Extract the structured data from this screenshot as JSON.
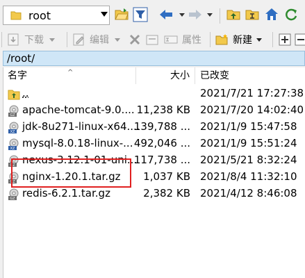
{
  "toolbar": {
    "directory": "root",
    "download_label": "下载",
    "edit_label": "编辑",
    "properties_label": "属性",
    "new_label": "新建"
  },
  "path": "/root/",
  "columns": {
    "name": "名字",
    "size": "大小",
    "modified": "已改变"
  },
  "files": [
    {
      "name": "..",
      "size": "",
      "modified": "2021/7/21 17:27:38",
      "icon": "parent-folder-icon"
    },
    {
      "name": "apache-tomcat-9.0....",
      "size": "11,238 KB",
      "modified": "2021/7/20 14:02:40",
      "icon": "gz-archive-icon"
    },
    {
      "name": "jdk-8u271-linux-x64....",
      "size": "139,788 ...",
      "modified": "2021/1/9 15:47:58",
      "icon": "xz-archive-icon"
    },
    {
      "name": "mysql-8.0.18-linux-...",
      "size": "492,046 ...",
      "modified": "2021/1/9 15:51:24",
      "icon": "xz-archive-icon"
    },
    {
      "name": "nexus-3.12.1-01-uni...",
      "size": "117,738 ...",
      "modified": "2021/5/21 8:32:24",
      "icon": "gz-archive-icon"
    },
    {
      "name": "nginx-1.20.1.tar.gz",
      "size": "1,037 KB",
      "modified": "2021/8/4 11:32:10",
      "icon": "gz-archive-icon"
    },
    {
      "name": "redis-6.2.1.tar.gz",
      "size": "2,382 KB",
      "modified": "2021/4/12 8:46:08",
      "icon": "gz-archive-icon"
    }
  ],
  "colors": {
    "path_bar": "#cfe6f7",
    "highlight": "#e02020",
    "folder": "#f2c94c"
  }
}
